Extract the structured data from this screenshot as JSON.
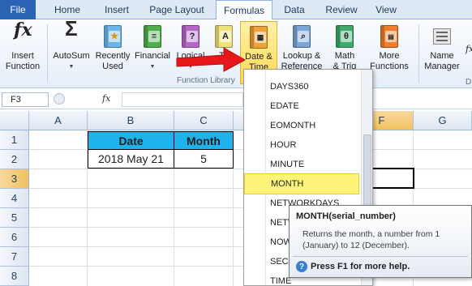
{
  "tabs": [
    {
      "label": "File"
    },
    {
      "label": "Home"
    },
    {
      "label": "Insert"
    },
    {
      "label": "Page Layout"
    },
    {
      "label": "Formulas"
    },
    {
      "label": "Data"
    },
    {
      "label": "Review"
    },
    {
      "label": "View"
    }
  ],
  "ribbon": {
    "insert_function": {
      "line1": "Insert",
      "line2": "Function",
      "icon": "fx"
    },
    "autosum": {
      "label": "AutoSum",
      "icon": "Σ"
    },
    "recently_used": {
      "line1": "Recently",
      "line2": "Used"
    },
    "financial": {
      "label": "Financial"
    },
    "logical": {
      "label": "Logical"
    },
    "text": {
      "label": "Te"
    },
    "date_time": {
      "line1": "Date &",
      "line2": "Time"
    },
    "lookup": {
      "line1": "Lookup &",
      "line2": "Reference"
    },
    "math": {
      "line1": "Math",
      "line2": "& Trig"
    },
    "more": {
      "line1": "More",
      "line2": "Functions"
    },
    "name_manager": {
      "line1": "Name",
      "line2": "Manager"
    },
    "group_label": "Function Library",
    "edge_char": "D",
    "fx_edge": "fx"
  },
  "formula_bar": {
    "name_box": "F3",
    "fx": "fx"
  },
  "columns": [
    "A",
    "B",
    "C",
    "D",
    "E",
    "F",
    "G"
  ],
  "rows": [
    "1",
    "2",
    "3",
    "4",
    "5",
    "6",
    "7",
    "8"
  ],
  "cells": {
    "B1": "Date",
    "C1": "Month",
    "B2": "2018  May 21",
    "C2": "5"
  },
  "dropdown": {
    "items": [
      "DAYS360",
      "EDATE",
      "EOMONTH",
      "HOUR",
      "MINUTE",
      "MONTH",
      "NETWORKDAYS",
      "NETW",
      "NOW",
      "SECO",
      "TIME"
    ],
    "highlighted": "MONTH"
  },
  "tooltip": {
    "title": "MONTH(serial_number)",
    "description": "Returns the month, a number from 1 (January) to 12 (December).",
    "help": "Press F1 for more help."
  },
  "colors": {
    "header_fill": "#1fb3ee",
    "highlight": "#fff47a",
    "arrow": "#e8171b",
    "file_tab": "#2a62b4"
  }
}
